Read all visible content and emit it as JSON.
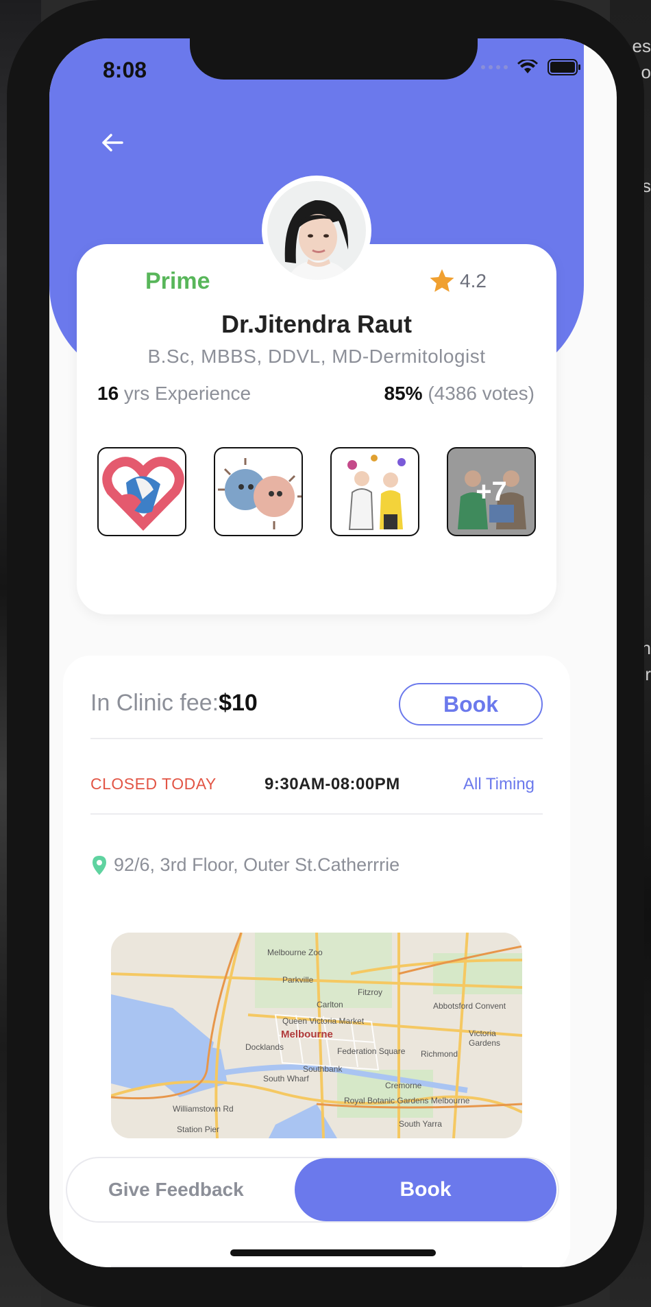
{
  "status_bar": {
    "time": "8:08"
  },
  "profile": {
    "badge": "Prime",
    "rating": "4.2",
    "name": "Dr.Jitendra Raut",
    "qualifications": "B.Sc, MBBS, DDVL, MD-Dermitologist",
    "experience_years": "16",
    "experience_label": " yrs Experience",
    "vote_percent": "85%",
    "vote_count": " (4386 votes)",
    "gallery_more": "+7"
  },
  "clinic": {
    "fee_label": "In Clinic fee:",
    "fee_value": "$10",
    "book_label": "Book",
    "status": "CLOSED TODAY",
    "hours": "9:30AM-08:00PM",
    "all_timing": "All Timing",
    "address": "92/6, 3rd Floor, Outer St.Catherrrie"
  },
  "map": {
    "city": "Melbourne",
    "labels": [
      "Melbourne Zoo",
      "Parkville",
      "Carlton",
      "Fitzroy",
      "Docklands",
      "Southbank",
      "South Wharf",
      "Federation Square",
      "Richmond",
      "Abbotsford Convent",
      "Victoria Gardens",
      "Royal Botanic Gardens Melbourne",
      "South Yarra",
      "Williamstown Rd",
      "Station Pier",
      "Queen Victoria Market",
      "Cremorne"
    ]
  },
  "bottom_bar": {
    "feedback_label": "Give Feedback",
    "book_label": "Book"
  },
  "colors": {
    "accent": "#6b79ec",
    "prime": "#58b65a",
    "closed": "#e25545",
    "star": "#f0a030",
    "pin": "#5fd3a0"
  },
  "background_hints": [
    "es",
    "o",
    "s",
    "n",
    "r"
  ]
}
